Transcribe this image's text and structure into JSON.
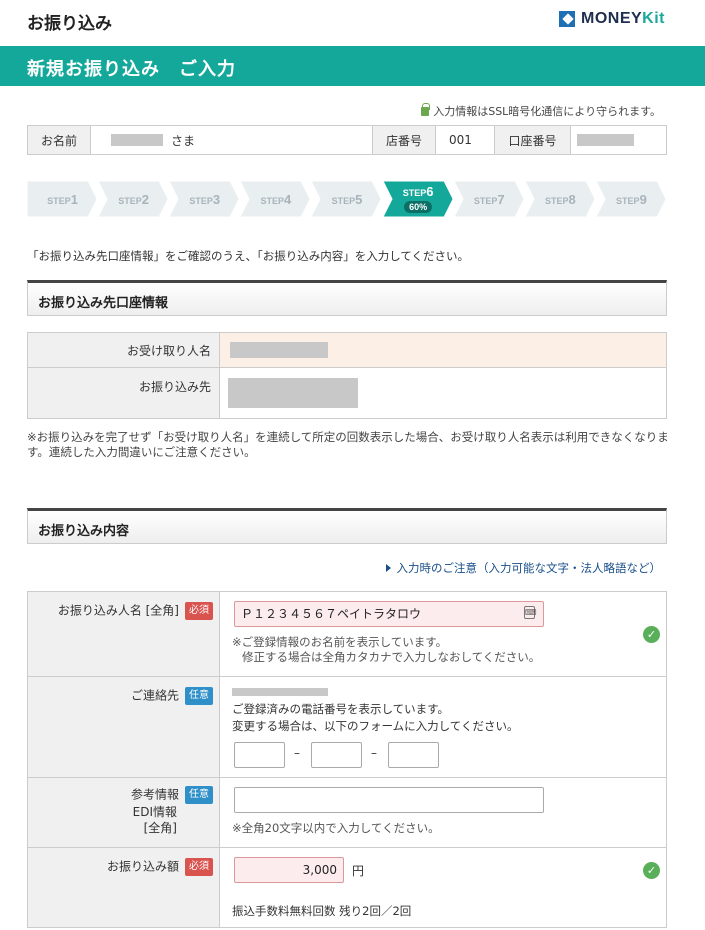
{
  "header": {
    "title": "お振り込み",
    "brand_prefix": "MONEY",
    "brand_suffix": "Kit"
  },
  "banner": {
    "title": "新規お振り込み　ご入力"
  },
  "ssl_notice": "入力情報はSSL暗号化通信により守られます。",
  "account": {
    "name_label": "お名前",
    "name_suffix": "さま",
    "branch_label": "店番号",
    "branch_value": "001",
    "account_label": "口座番号"
  },
  "steps": {
    "items": [
      "STEP1",
      "STEP2",
      "STEP3",
      "STEP4",
      "STEP5",
      "STEP6",
      "STEP7",
      "STEP8",
      "STEP9"
    ],
    "current": 6,
    "progress": "60%",
    "active_color": "#13a89a",
    "inactive_color": "#e9eef0"
  },
  "instruction": "「お振り込み先口座情報」をご確認のうえ、「お振り込み内容」を入力してください。",
  "dest_section": {
    "title": "お振り込み先口座情報",
    "recipient_label": "お受け取り人名",
    "dest_label": "お振り込み先"
  },
  "note": "※お振り込みを完了せず「お受け取り人名」を連続して所定の回数表示した場合、お受け取り人名表示は利用できなくなります。連続した入力間違いにご注意ください。",
  "content_section": {
    "title": "お振り込み内容"
  },
  "caution_link": "入力時のご注意（入力可能な文字・法人略語など）",
  "form": {
    "badge_required": "必須",
    "badge_optional": "任意",
    "payer": {
      "label": "お振り込み人名 [全角]",
      "value": "Ｐ１２３４５６７ペイトラタロウ",
      "hint1": "※ご登録情報のお名前を表示しています。",
      "hint2": "修正する場合は全角カタカナで入力しなおしてください。"
    },
    "contact": {
      "label": "ご連絡先",
      "hint1": "ご登録済みの電話番号を表示しています。",
      "hint2": "変更する場合は、以下のフォームに入力してください。",
      "dash": "–"
    },
    "ref": {
      "label1": "参考情報",
      "label2": "EDI情報",
      "label3": "[全角]",
      "hint": "※全角20文字以内で入力してください。"
    },
    "amount": {
      "label": "お振り込み額",
      "value": "3,000",
      "unit": "円",
      "fee_note": "振込手数料無料回数 残り2回／2回"
    },
    "check_symbol": "✓"
  }
}
